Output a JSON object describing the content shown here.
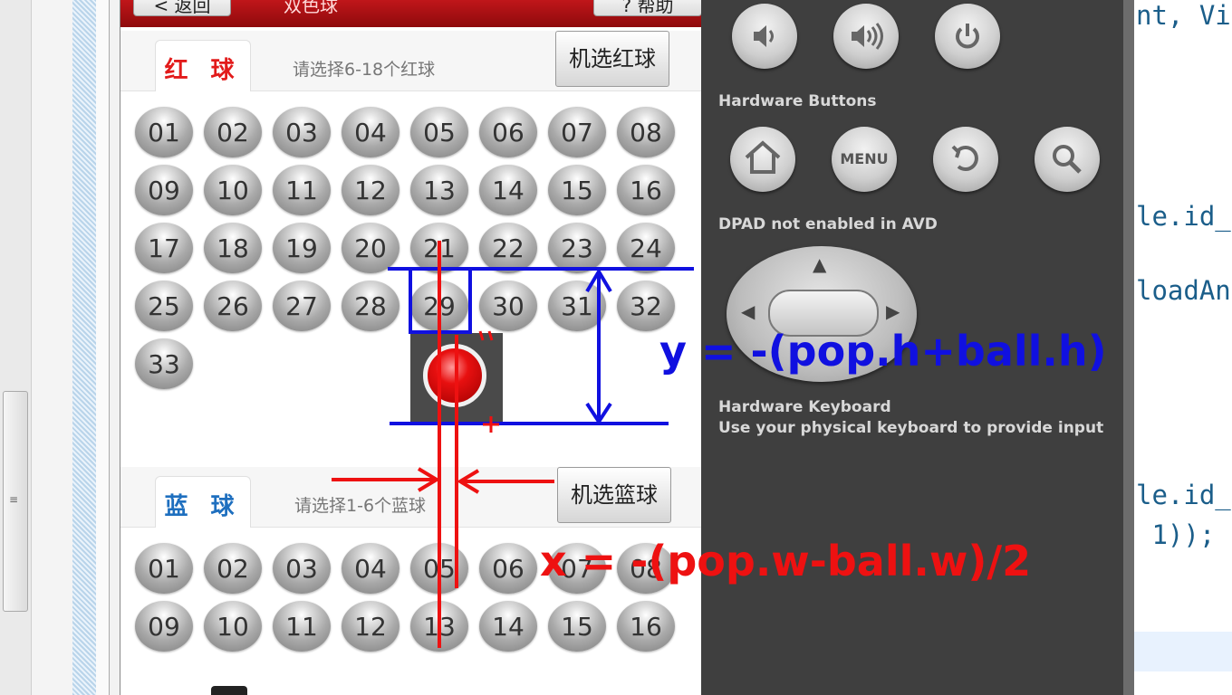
{
  "app": {
    "back_label": "< 返回",
    "help_label": "? 帮助",
    "title_partial": "双色球"
  },
  "red_section": {
    "tab_label": "红 球",
    "hint": "请选择6-18个红球",
    "machine_button": "机选红球",
    "balls": [
      "01",
      "02",
      "03",
      "04",
      "05",
      "06",
      "07",
      "08",
      "09",
      "10",
      "11",
      "12",
      "13",
      "14",
      "15",
      "16",
      "17",
      "18",
      "19",
      "20",
      "21",
      "22",
      "23",
      "24",
      "25",
      "26",
      "27",
      "28",
      "29",
      "30",
      "31",
      "32",
      "33"
    ]
  },
  "blue_section": {
    "tab_label": "蓝 球",
    "hint": "请选择1-6个蓝球",
    "machine_button": "机选篮球",
    "balls": [
      "01",
      "02",
      "03",
      "04",
      "05",
      "06",
      "07",
      "08",
      "09",
      "10",
      "11",
      "12",
      "13",
      "14",
      "15",
      "16"
    ]
  },
  "emulator": {
    "hardware_buttons_label": "Hardware Buttons",
    "menu_label": "MENU",
    "dpad_label_bold": "DPAD",
    "dpad_label_rest": " not enabled in AVD",
    "keyboard_title": "Hardware Keyboard",
    "keyboard_desc": "Use your physical keyboard to provide input"
  },
  "code_lines": [
    {
      "text": "nt, Vi"
    },
    {
      "text": "le.id_"
    },
    {
      "text": "loadAn"
    },
    {
      "text": "le.id_"
    },
    {
      "text": " 1));"
    }
  ],
  "annotations": {
    "y_formula": "y = -(pop.h+ball.h)",
    "x_formula": "x = -(pop.w-ball.w)/2",
    "blue_color": "#1010e0",
    "red_color": "#ee1111"
  },
  "colors": {
    "red_tab": "#e21b1b",
    "blue_tab": "#1e6fbf",
    "title_bar": "#b01215"
  }
}
